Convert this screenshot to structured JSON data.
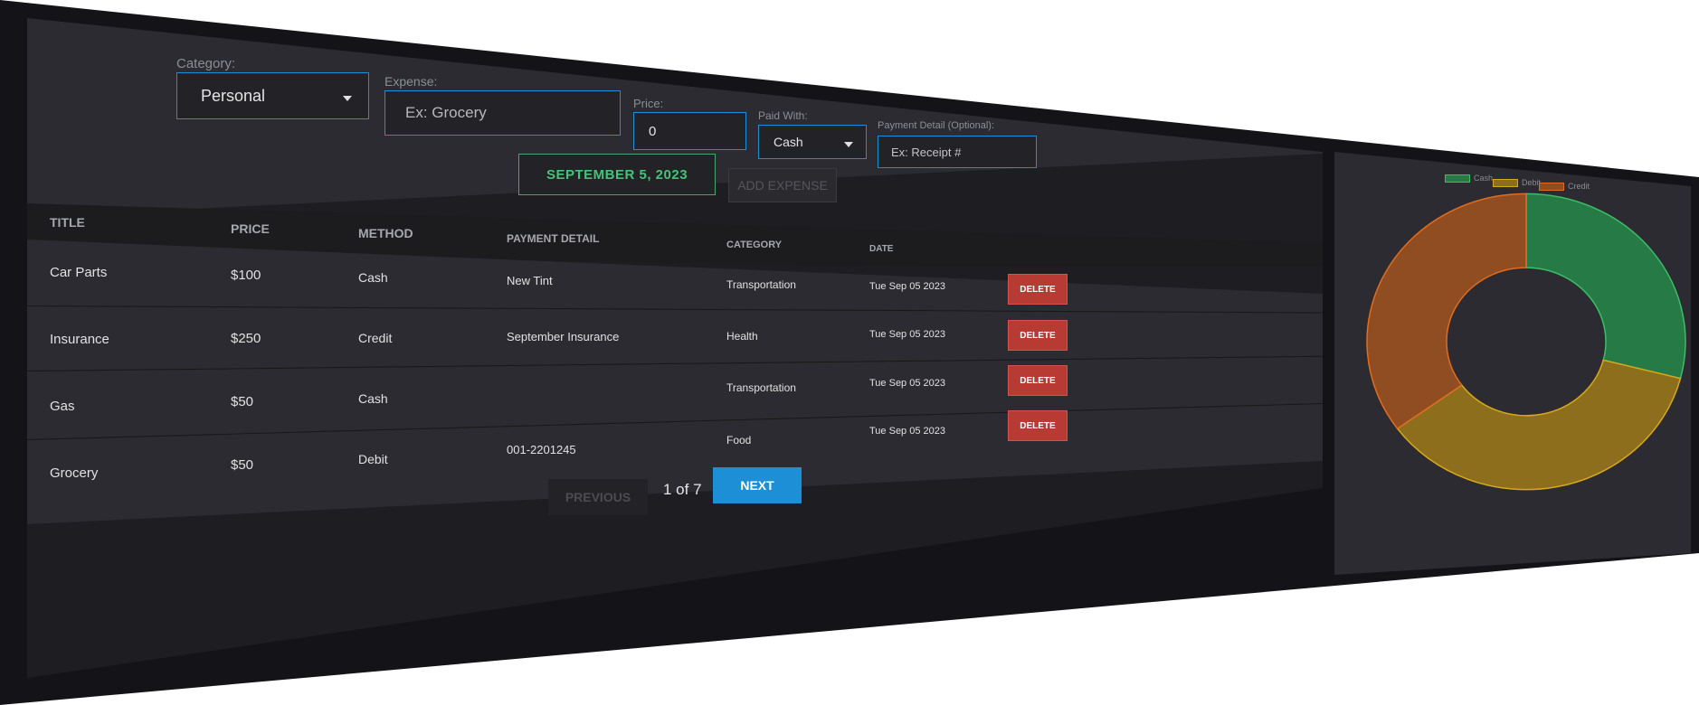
{
  "form": {
    "category_label": "Category:",
    "category_value": "Personal",
    "expense_label": "Expense:",
    "expense_placeholder": "Ex: Grocery",
    "price_label": "Price:",
    "price_value": "0",
    "paid_with_label": "Paid With:",
    "paid_with_value": "Cash",
    "payment_detail_label": "Payment Detail (Optional):",
    "payment_detail_placeholder": "Ex: Receipt #",
    "date_button": "SEPTEMBER 5, 2023",
    "add_button": "ADD EXPENSE"
  },
  "table": {
    "headers": [
      "TITLE",
      "PRICE",
      "METHOD",
      "PAYMENT DETAIL",
      "CATEGORY",
      "DATE"
    ],
    "rows": [
      {
        "title": "Car Parts",
        "price": "$100",
        "method": "Cash",
        "detail": "New Tint",
        "category": "Transportation",
        "date": "Tue Sep 05 2023",
        "action": "DELETE"
      },
      {
        "title": "Insurance",
        "price": "$250",
        "method": "Credit",
        "detail": "September Insurance",
        "category": "Health",
        "date": "Tue Sep 05 2023",
        "action": "DELETE"
      },
      {
        "title": "Gas",
        "price": "$50",
        "method": "Cash",
        "detail": "",
        "category": "Transportation",
        "date": "Tue Sep 05 2023",
        "action": "DELETE"
      },
      {
        "title": "Grocery",
        "price": "$50",
        "method": "Debit",
        "detail": "001-2201245",
        "category": "Food",
        "date": "Tue Sep 05 2023",
        "action": "DELETE"
      }
    ]
  },
  "pagination": {
    "previous": "PREVIOUS",
    "status": "1 of 7",
    "next": "NEXT"
  },
  "chart_data": {
    "type": "pie",
    "legend": [
      "Cash",
      "Debit",
      "Credit"
    ],
    "values": [
      29,
      36,
      35
    ],
    "colors": [
      "#257a45",
      "#8c6e1d",
      "#914d22"
    ],
    "borders": [
      "#3bbf65",
      "#d8a91c",
      "#e06d1f"
    ],
    "legend_position": "top"
  }
}
